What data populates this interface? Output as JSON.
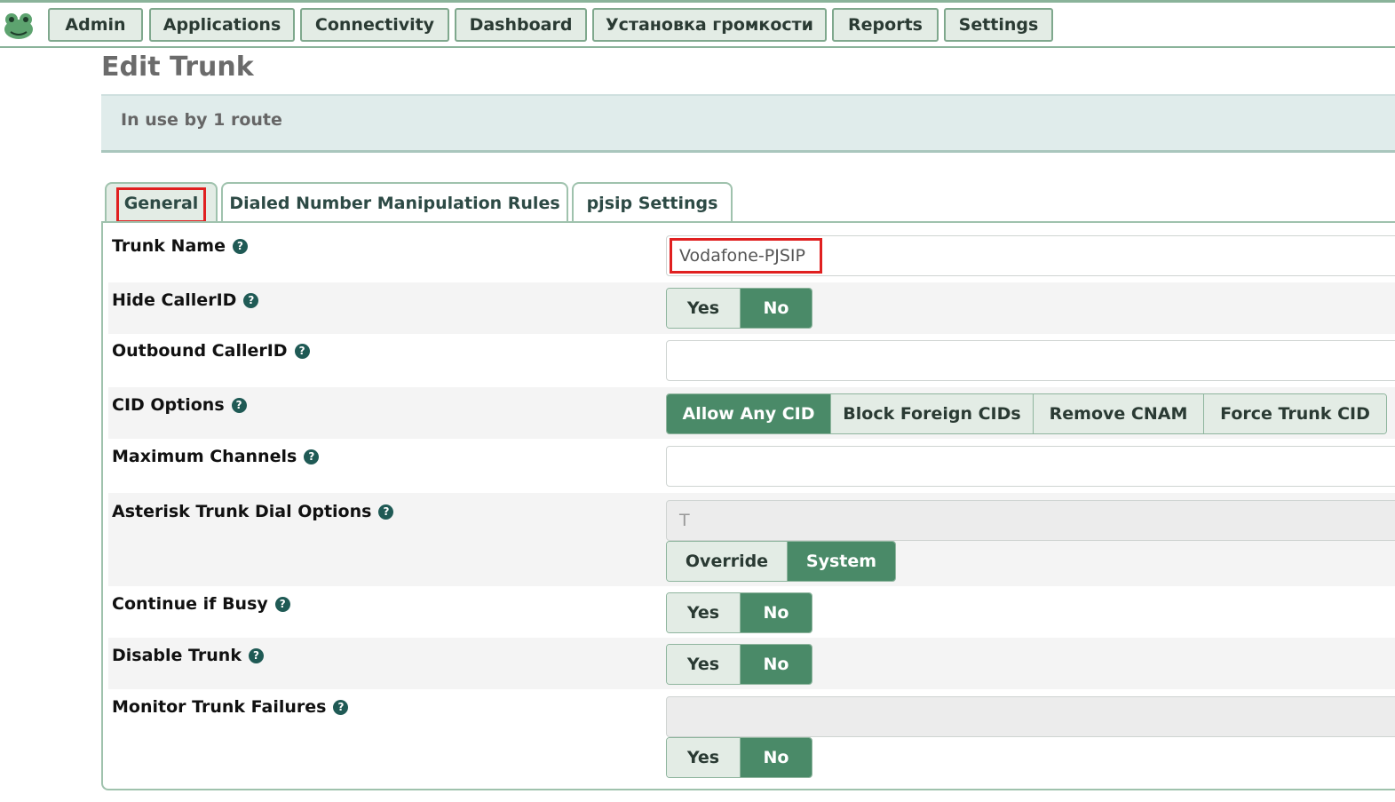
{
  "nav": {
    "items": [
      "Admin",
      "Applications",
      "Connectivity",
      "Dashboard",
      "Установка громкости",
      "Reports",
      "Settings"
    ]
  },
  "page": {
    "title": "Edit Trunk",
    "usage": "In use by 1 route"
  },
  "tabs": [
    {
      "label": "General",
      "active": true
    },
    {
      "label": "Dialed Number Manipulation Rules",
      "active": false
    },
    {
      "label": "pjsip Settings",
      "active": false
    }
  ],
  "form": {
    "trunk_name": {
      "label": "Trunk Name",
      "value": "Vodafone-PJSIP"
    },
    "hide_callerid": {
      "label": "Hide CallerID",
      "yes": "Yes",
      "no": "No",
      "selected": "No"
    },
    "outbound_callerid": {
      "label": "Outbound CallerID",
      "value": ""
    },
    "cid_options": {
      "label": "CID Options",
      "options": [
        "Allow Any CID",
        "Block Foreign CIDs",
        "Remove CNAM",
        "Force Trunk CID"
      ],
      "selected": "Allow Any CID"
    },
    "max_channels": {
      "label": "Maximum Channels",
      "value": ""
    },
    "dial_options": {
      "label": "Asterisk Trunk Dial Options",
      "value": "T",
      "override": "Override",
      "system": "System",
      "selected": "System"
    },
    "continue_busy": {
      "label": "Continue if Busy",
      "yes": "Yes",
      "no": "No",
      "selected": "No"
    },
    "disable_trunk": {
      "label": "Disable Trunk",
      "yes": "Yes",
      "no": "No",
      "selected": "No"
    },
    "monitor_failures": {
      "label": "Monitor Trunk Failures",
      "value": "",
      "yes": "Yes",
      "no": "No",
      "selected": "No"
    }
  },
  "colors": {
    "accent_green": "#4a8a68",
    "highlight_red": "#e02020"
  }
}
